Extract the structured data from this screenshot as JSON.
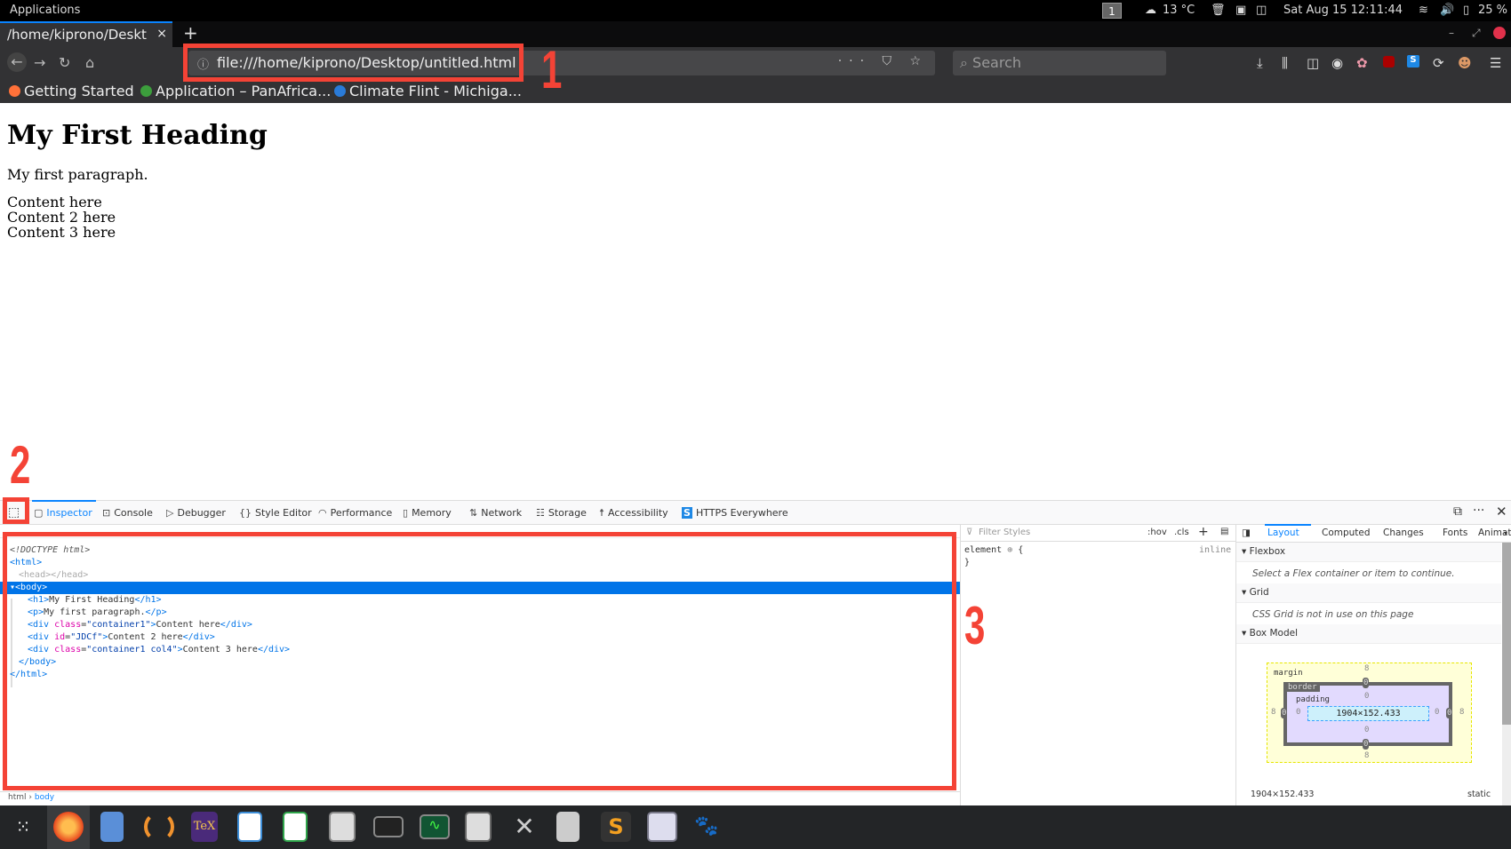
{
  "top_panel": {
    "applications_label": "Applications",
    "workspace": "1",
    "weather": "13 °C",
    "datetime": "Sat Aug 15  12:11:44",
    "battery": "25 %"
  },
  "browser": {
    "tab_title": "/home/kiprono/Deskt",
    "tab_close": "×",
    "new_tab": "+",
    "url": "file:///home/kiprono/Desktop/untitled.html",
    "url_actions": "··· ⛉ ☆",
    "search_placeholder": "Search",
    "bookmarks": [
      {
        "label": "Getting Started",
        "color": "#ff7139"
      },
      {
        "label": "Application – PanAfrica...",
        "color": "#3c9e3c"
      },
      {
        "label": "Climate Flint - Michiga...",
        "color": "#2a7bd8"
      }
    ]
  },
  "page": {
    "heading": "My First Heading",
    "paragraph": "My first paragraph.",
    "contents": [
      "Content here",
      "Content 2 here",
      "Content 3 here"
    ]
  },
  "devtools": {
    "tabs": [
      {
        "label": "Inspector",
        "icon": "▢"
      },
      {
        "label": "Console",
        "icon": "⊡"
      },
      {
        "label": "Debugger",
        "icon": "▷"
      },
      {
        "label": "Style Editor",
        "icon": "{}"
      },
      {
        "label": "Performance",
        "icon": "◠"
      },
      {
        "label": "Memory",
        "icon": "▯"
      },
      {
        "label": "Network",
        "icon": "⇅"
      },
      {
        "label": "Storage",
        "icon": "☷"
      },
      {
        "label": "Accessibility",
        "icon": "☨"
      },
      {
        "label": "HTTPS Everywhere",
        "icon": "S"
      }
    ],
    "markup": {
      "doctype": "<!DOCTYPE html>",
      "html_open": "<html>",
      "head": "<head></head>",
      "body_open": "<body>",
      "h1": {
        "tag": "h1",
        "text": "My First Heading"
      },
      "p": {
        "tag": "p",
        "text": "My first paragraph."
      },
      "div1": {
        "attr": "class",
        "value": "\"container1\"",
        "text": "Content here"
      },
      "div2": {
        "attr": "id",
        "value": "\"JDCf\"",
        "text": "Content 2 here"
      },
      "div3": {
        "attr": "class",
        "value": "\"container1 col4\"",
        "text": "Content 3 here"
      },
      "body_close": "</body>",
      "html_close": "</html>"
    },
    "breadcrumb": [
      "html",
      "body"
    ],
    "rules": {
      "filter_placeholder": "Filter Styles",
      "hov": ":hov",
      "cls": ".cls",
      "selector": "element",
      "brace_open": "{",
      "brace_close": "}",
      "source": "inline"
    },
    "layout_tabs": [
      "Layout",
      "Computed",
      "Changes",
      "Fonts",
      "Animat"
    ],
    "sections": {
      "flexbox": "Flexbox",
      "flexbox_msg": "Select a Flex container or item to continue.",
      "grid": "Grid",
      "grid_msg": "CSS Grid is not in use on this page",
      "box_model": "Box Model"
    },
    "box_model": {
      "margin_label": "margin",
      "border_label": "border",
      "padding_label": "padding",
      "margin": {
        "top": "8",
        "right": "8",
        "bottom": "8",
        "left": "8"
      },
      "border": {
        "top": "0",
        "right": "0",
        "bottom": "0",
        "left": "0"
      },
      "padding": {
        "top": "0",
        "right": "0",
        "bottom": "0",
        "left": "0"
      },
      "content": "1904×152.433",
      "size_summary": "1904×152.433",
      "position": "static"
    }
  },
  "annotations": [
    "1",
    "2",
    "3"
  ],
  "taskbar_apps": [
    "app-grid",
    "firefox",
    "files",
    "eclipse",
    "texmaker",
    "writer",
    "calc",
    "calculator",
    "terminal",
    "system-monitor",
    "mixer",
    "settings",
    "software-store",
    "sublime-text",
    "screenshot",
    "gimp"
  ]
}
